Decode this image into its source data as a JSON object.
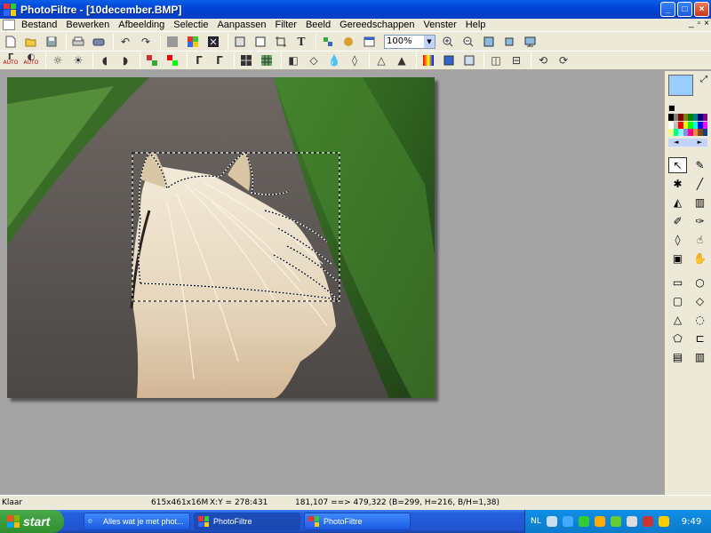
{
  "window": {
    "title": "PhotoFiltre - [10december.BMP]",
    "minimize": "_",
    "maximize": "□",
    "close": "×"
  },
  "menu": [
    "Bestand",
    "Bewerken",
    "Afbeelding",
    "Selectie",
    "Aanpassen",
    "Filter",
    "Beeld",
    "Gereedschappen",
    "Venster",
    "Help"
  ],
  "mdi_controls": [
    "_",
    "▫",
    "×"
  ],
  "toolbar1": {
    "icons": [
      "new-icon",
      "open-icon",
      "save-icon",
      "print-icon",
      "scan-icon",
      "undo-icon",
      "redo-icon",
      "grey-icon",
      "color-icon",
      "copy-icon",
      "paste-icon",
      "paste-new-icon",
      "crop-icon",
      "text-icon",
      "plugin-icon",
      "effects-icon",
      "browser-icon"
    ],
    "zoom": "100%",
    "view_icons": [
      "zoom-in-icon",
      "zoom-out-icon",
      "fit-icon",
      "actual-size-icon",
      "fullscreen-icon"
    ]
  },
  "toolbar2": {
    "auto_label": "AUTO"
  },
  "colors": {
    "foreground": "#99ccff",
    "background": "#ffffff"
  },
  "tools": [
    "select-tool",
    "picker-tool",
    "magic-wand-tool",
    "line-tool",
    "fill-tool",
    "spray-tool",
    "brush-tool",
    "advanced-brush-tool",
    "blur-tool",
    "smudge-tool",
    "stamp-tool",
    "hand-tool"
  ],
  "shapes": [
    "rectangle-icon",
    "ellipse-icon",
    "rounded-rect-icon",
    "diamond-icon",
    "triangle-icon",
    "lasso-icon",
    "polygon-icon",
    "open-shape-icon",
    "hsel-icon",
    "vsel-icon"
  ],
  "status": {
    "state": "Klaar",
    "size": "615x461x16M",
    "coords": "X:Y = 278:431",
    "selection": "181,107 ==> 479,322 (B=299, H=216, B/H=1,38)"
  },
  "taskbar": {
    "start": "start",
    "tasks": [
      {
        "label": "Alles wat je met phot...",
        "active": false
      },
      {
        "label": "PhotoFiltre",
        "active": true
      },
      {
        "label": "PhotoFiltre",
        "active": false
      }
    ],
    "lang": "NL",
    "clock": "9:49"
  }
}
